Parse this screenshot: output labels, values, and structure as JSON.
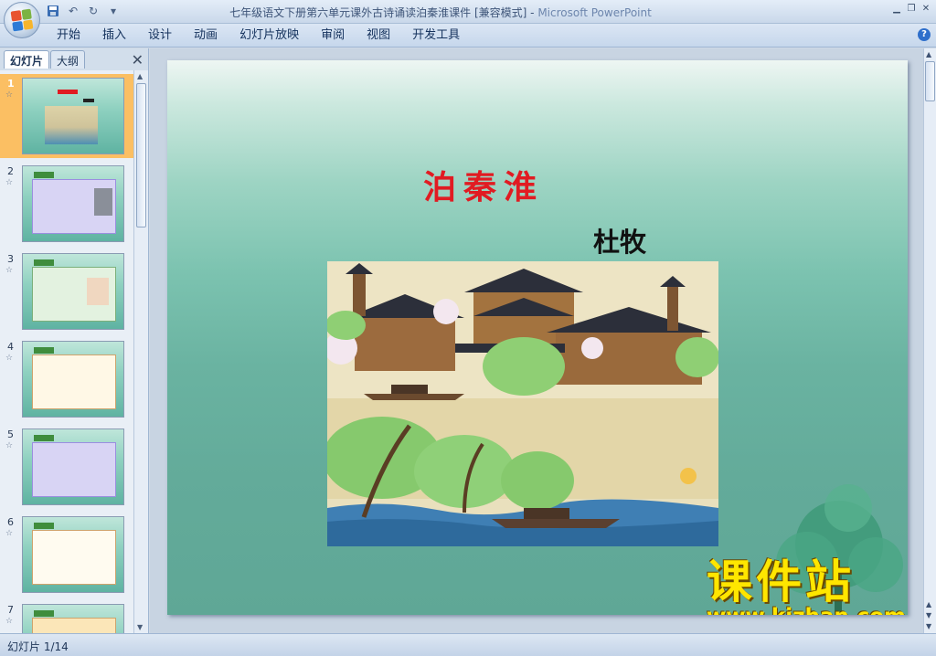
{
  "window": {
    "title_doc": "七年级语文下册第六单元课外古诗诵读泊秦淮课件 [兼容模式] - ",
    "title_app": "Microsoft PowerPoint",
    "controls": [
      "minimize-icon",
      "restore-icon",
      "close-icon"
    ]
  },
  "quick_access": [
    "save-icon",
    "undo-icon",
    "redo-icon",
    "customize-icon"
  ],
  "ribbon": {
    "tabs": [
      "开始",
      "插入",
      "设计",
      "动画",
      "幻灯片放映",
      "审阅",
      "视图",
      "开发工具"
    ]
  },
  "left_pane": {
    "tab_slides": "幻灯片",
    "tab_outline": "大纲",
    "thumbnails": [
      {
        "num": "1",
        "selected": true
      },
      {
        "num": "2",
        "selected": false
      },
      {
        "num": "3",
        "selected": false
      },
      {
        "num": "4",
        "selected": false
      },
      {
        "num": "5",
        "selected": false
      },
      {
        "num": "6",
        "selected": false
      },
      {
        "num": "7",
        "selected": false
      }
    ]
  },
  "slide": {
    "title": "泊秦淮",
    "author": "杜牧"
  },
  "watermark": {
    "brand": "课件站",
    "url": "www.kjzhan.com"
  },
  "status": {
    "slide_counter": "幻灯片 1/14"
  },
  "colors": {
    "title_red": "#e11b22",
    "selected_thumb": "#fbbf63",
    "watermark_yellow": "#ffe600"
  }
}
